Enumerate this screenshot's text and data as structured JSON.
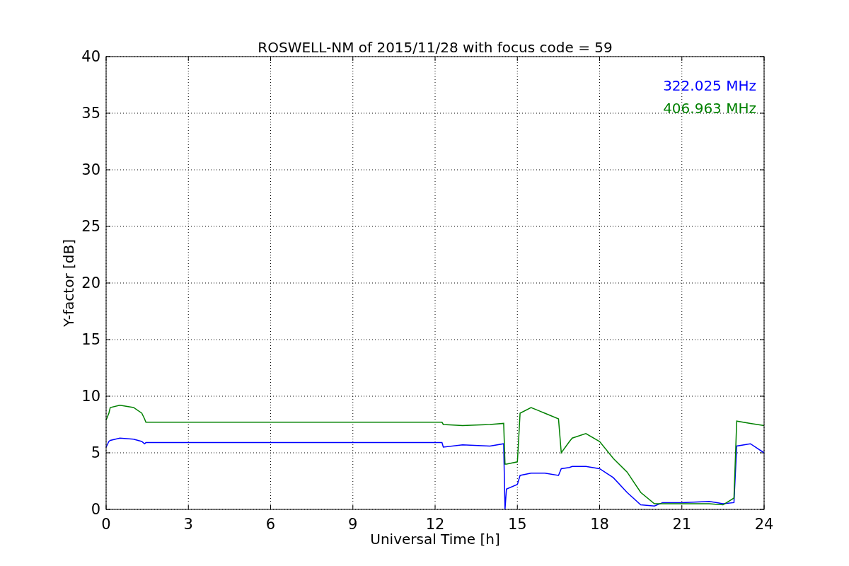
{
  "figure": {
    "chart_data": {
      "type": "line",
      "title": "ROSWELL-NM of 2015/11/28 with focus code = 59",
      "xlabel": "Universal Time [h]",
      "ylabel": "Y-factor [dB]",
      "x": [
        0,
        0.1,
        0.15,
        0.5,
        1.0,
        1.3,
        1.4,
        1.45,
        12.25,
        12.3,
        13,
        14,
        14.5,
        14.55,
        14.6,
        15,
        15.1,
        15.5,
        16,
        16.5,
        16.6,
        16.9,
        17,
        17.5,
        18,
        18.5,
        19,
        19.5,
        20,
        20.3,
        21,
        22,
        22.5,
        22.9,
        23,
        23.5,
        24
      ],
      "series": [
        {
          "name": "322.025 MHz",
          "color": "#0000ff",
          "values": [
            5.5,
            6.0,
            6.1,
            6.3,
            6.2,
            6.0,
            5.8,
            5.9,
            5.9,
            5.5,
            5.7,
            5.6,
            5.8,
            0,
            1.8,
            2.2,
            3.0,
            3.2,
            3.2,
            3.0,
            3.6,
            3.7,
            3.8,
            3.8,
            3.6,
            2.8,
            1.5,
            0.4,
            0.3,
            0.6,
            0.6,
            0.7,
            0.5,
            0.6,
            5.6,
            5.8,
            5.0
          ]
        },
        {
          "name": "406.963 MHz",
          "color": "#008000",
          "values": [
            7.9,
            8.5,
            9.0,
            9.2,
            9.0,
            8.5,
            8.0,
            7.7,
            7.7,
            7.5,
            7.4,
            7.5,
            7.6,
            4.0,
            4.0,
            4.2,
            8.5,
            9.0,
            8.5,
            8.0,
            5.0,
            6.0,
            6.3,
            6.7,
            6.0,
            4.5,
            3.3,
            1.5,
            0.5,
            0.5,
            0.5,
            0.5,
            0.4,
            1.0,
            7.8,
            7.6,
            7.4
          ]
        }
      ],
      "grid": true,
      "xlim": [
        0,
        24
      ],
      "ylim": [
        0,
        40
      ],
      "xticks": [
        0,
        3,
        6,
        9,
        12,
        15,
        18,
        21,
        24
      ],
      "yticks": [
        0,
        5,
        10,
        15,
        20,
        25,
        30,
        35,
        40
      ]
    }
  }
}
